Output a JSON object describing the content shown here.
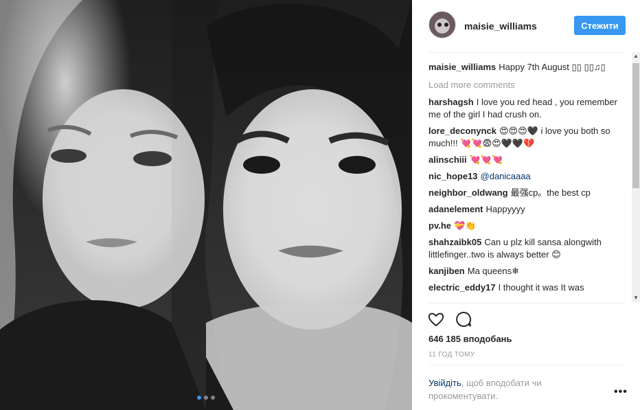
{
  "photo": {
    "alt_icon": "photo-carousel",
    "carousel_dots": 3,
    "carousel_active_index": 0
  },
  "header": {
    "username": "maisie_williams",
    "follow_label": "Стежити",
    "accent_color": "#3897f0"
  },
  "caption": {
    "user": "maisie_williams",
    "text": "Happy 7th August ▯▯ ▯▯♫▯"
  },
  "load_more_label": "Load more comments",
  "comments": [
    {
      "user": "harshagsh",
      "text": "I love you red head , you remember me of the girl I had crush on."
    },
    {
      "user": "lore_deconynck",
      "text": "😍😍😍🖤 i love you both so much!!! 💘💘😨😍🖤🖤💔"
    },
    {
      "user": "alinschiii",
      "text": "💘💘💘"
    },
    {
      "user": "nic_hope13",
      "text": "@danicaaaa",
      "is_mention": true
    },
    {
      "user": "neighbor_oldwang",
      "text": "最强cp。the best cp"
    },
    {
      "user": "adanelement",
      "text": "Happyyyy"
    },
    {
      "user": "pv.he",
      "text": "💝👏"
    },
    {
      "user": "shahzaibk05",
      "text": "Can u plz kill sansa alongwith littlefinger..two is always better 😊"
    },
    {
      "user": "kanjiben",
      "text": "Ma queens❄"
    },
    {
      "user": "electric_eddy17",
      "text": "I thought it was It was"
    }
  ],
  "actions": {
    "like_icon": "heart-icon",
    "comment_icon": "comment-icon"
  },
  "likes": "646 185 вподобань",
  "time_ago": "11 год тому",
  "login": {
    "link": "Увійдіть",
    "rest": ", щоб вподобати чи прокоментувати."
  },
  "more_label": "•••"
}
